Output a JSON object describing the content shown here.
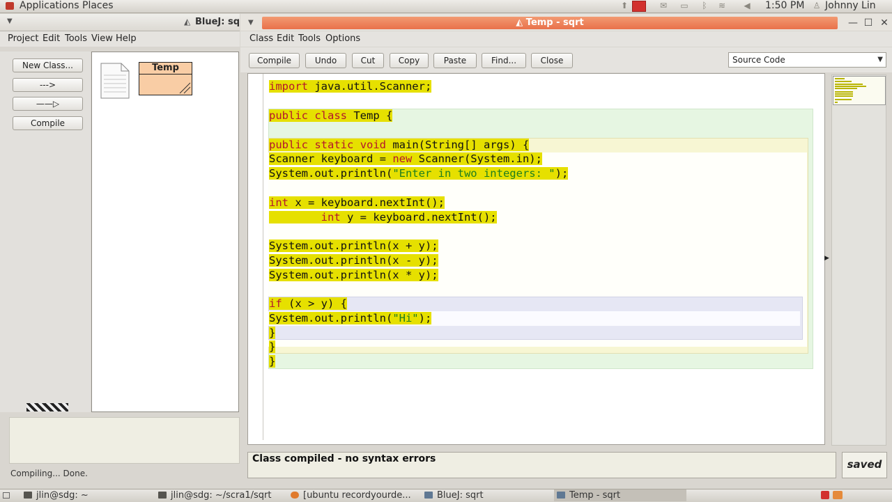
{
  "top_panel": {
    "applications": "Applications",
    "places": "Places",
    "clock": "1:50 PM",
    "user": "Johnny Lin"
  },
  "bluej_window": {
    "title": "BlueJ:  sqrt",
    "menu": [
      "Project",
      "Edit",
      "Tools",
      "View",
      "Help"
    ],
    "buttons": {
      "new_class": "New Class...",
      "uses_arrow": "--->",
      "inherit_arrow": "——▷",
      "compile": "Compile"
    },
    "class_box_label": "Temp",
    "status": "Compiling... Done."
  },
  "editor_window": {
    "title": "Temp - sqrt",
    "menu": [
      "Class",
      "Edit",
      "Tools",
      "Options"
    ],
    "toolbar": [
      "Compile",
      "Undo",
      "Cut",
      "Copy",
      "Paste",
      "Find...",
      "Close"
    ],
    "view_select": "Source Code",
    "status_message": "Class compiled - no syntax errors",
    "saved_label": "saved"
  },
  "taskbar": {
    "items": [
      "jlin@sdg: ~",
      "jlin@sdg: ~/scra1/sqrt",
      "[ubuntu recordyourde...",
      "BlueJ:  sqrt",
      "Temp - sqrt"
    ]
  },
  "colors": {
    "title_orange": "#ec7c54",
    "highlight_yellow": "#e6e000",
    "keyword_red": "#b4162c",
    "string_green": "#1f7e1f"
  }
}
